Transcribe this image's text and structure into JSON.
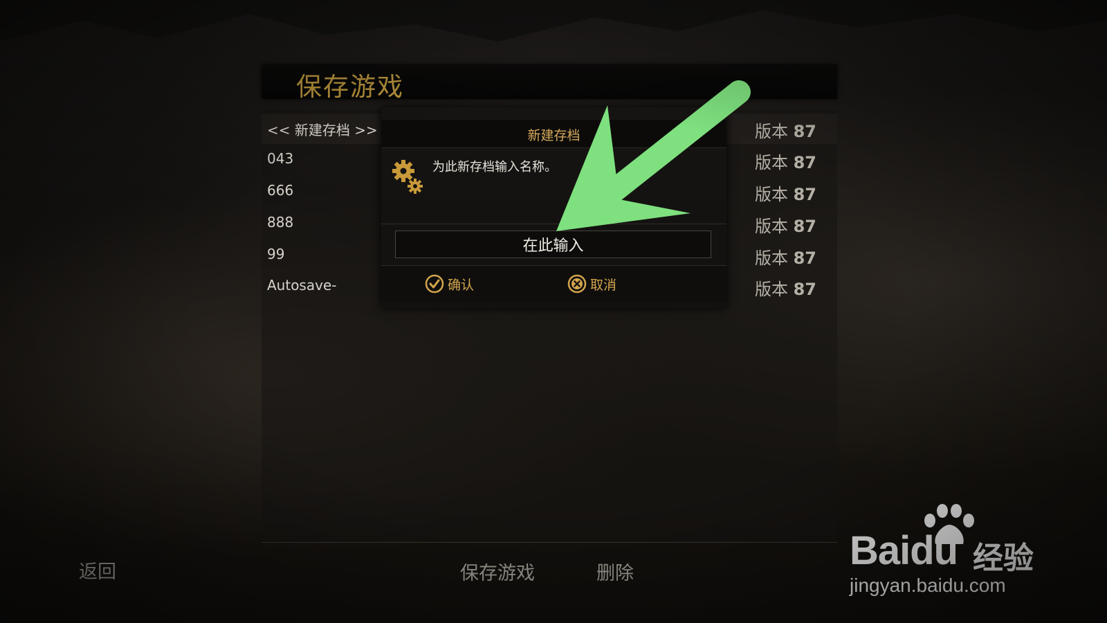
{
  "screen": {
    "title": "保存游戏"
  },
  "save_list": [
    {
      "name": "<< 新建存档 >>",
      "version_label": "版本",
      "version_number": "87"
    },
    {
      "name": "043",
      "version_label": "版本",
      "version_number": "87"
    },
    {
      "name": "666",
      "version_label": "版本",
      "version_number": "87"
    },
    {
      "name": "888",
      "version_label": "版本",
      "version_number": "87"
    },
    {
      "name": "99",
      "version_label": "版本",
      "version_number": "87"
    },
    {
      "name": "Autosave-",
      "version_label": "版本",
      "version_number": "87"
    }
  ],
  "dialog": {
    "title": "新建存档",
    "prompt": "为此新存档输入名称。",
    "input_value": "在此输入",
    "confirm_label": "确认",
    "cancel_label": "取消"
  },
  "bottom_actions": {
    "back_label": "返回",
    "save_label": "保存游戏",
    "delete_label": "删除"
  },
  "watermark": {
    "logo_text": "Baidu",
    "cn_text": "经验",
    "url": "jingyan.baidu.com"
  },
  "colors": {
    "gold": "#b8933c",
    "dialog_title": "#d5a95a",
    "button_gold": "#d3a54c",
    "arrow_green": "#7ee07e"
  }
}
